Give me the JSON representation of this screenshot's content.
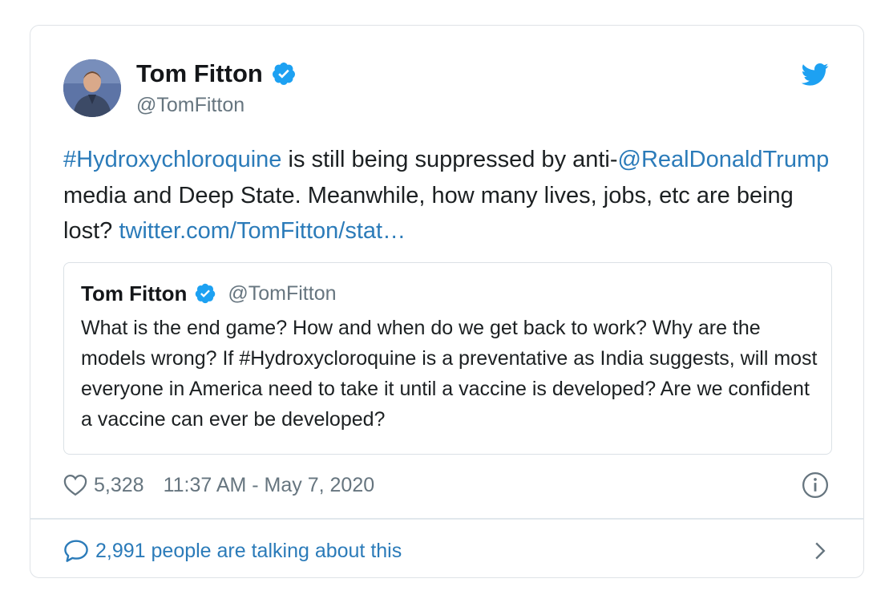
{
  "author": {
    "name": "Tom Fitton",
    "handle": "@TomFitton"
  },
  "tweet": {
    "parts": [
      {
        "text": "#Hydroxychloroquine",
        "link": true
      },
      {
        "text": " is still being suppressed by anti-",
        "link": false
      },
      {
        "text": "@RealDonaldTrump",
        "link": true
      },
      {
        "text": " media and Deep State.  Meanwhile, how many lives, jobs, etc are being lost? ",
        "link": false
      },
      {
        "text": "twitter.com/TomFitton/stat…",
        "link": true
      }
    ]
  },
  "quoted": {
    "name": "Tom Fitton",
    "handle": "@TomFitton",
    "text": "What is the end game?  How and when do we get back to work?  Why are the models wrong?  If #Hydroxycloroquine is a preventative as India suggests, will most everyone in America need to take it until a vaccine is developed? Are we confident a vaccine can ever be developed?"
  },
  "meta": {
    "likes": "5,328",
    "timestamp": "11:37 AM - May 7, 2020"
  },
  "conversation": {
    "label": "2,991 people are talking about this"
  },
  "icons": {
    "verified": "verified-badge-icon",
    "brand": "twitter-bird-icon",
    "like": "heart-icon",
    "info": "info-icon",
    "reply": "speech-bubble-icon",
    "next": "chevron-right-icon"
  },
  "colors": {
    "link": "#2b7bb9",
    "verified": "#1da1f2",
    "text": "#1c2022",
    "muted": "#66757f",
    "border": "#dfe3e7"
  }
}
